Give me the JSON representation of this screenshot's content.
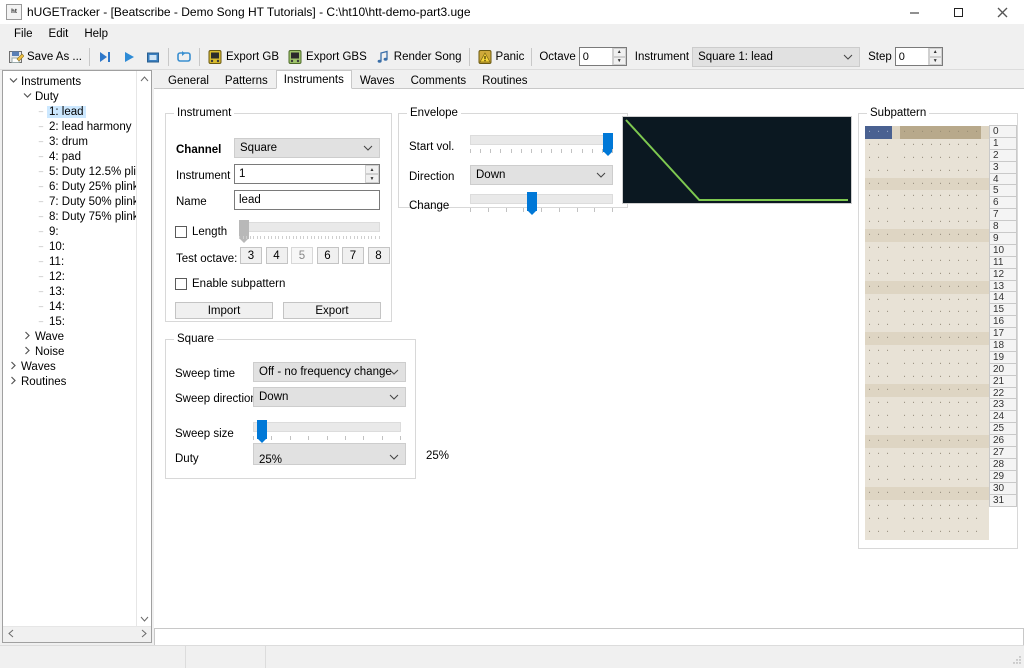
{
  "window": {
    "title": "hUGETracker - [Beatscribe - Demo Song HT Tutorials] - C:\\ht10\\htt-demo-part3.uge",
    "app_icon": "hugetracker-icon",
    "minimize": "–",
    "maximize": "☐",
    "close": "✕"
  },
  "menu": {
    "items": [
      "File",
      "Edit",
      "Help"
    ]
  },
  "toolbar": {
    "save_as": "Save As ...",
    "skip_label": "",
    "play_label": "",
    "stop_label": "",
    "loop_label": "",
    "export_gb": "Export GB",
    "export_gbs": "Export GBS",
    "render_song": "Render Song",
    "panic": "Panic",
    "octave_label": "Octave",
    "octave_value": "0",
    "instrument_label": "Instrument",
    "instrument_value": "Square 1: lead",
    "step_label": "Step",
    "step_value": "0"
  },
  "tree": {
    "nodes": [
      {
        "label": "Instruments",
        "depth": 0,
        "twist": "expanded",
        "selected": false
      },
      {
        "label": "Duty",
        "depth": 1,
        "twist": "expanded",
        "selected": false
      },
      {
        "label": "1: lead",
        "depth": 2,
        "twist": "leaf",
        "selected": true
      },
      {
        "label": "2: lead harmony",
        "depth": 2,
        "twist": "leaf",
        "selected": false
      },
      {
        "label": "3: drum",
        "depth": 2,
        "twist": "leaf",
        "selected": false
      },
      {
        "label": "4: pad",
        "depth": 2,
        "twist": "leaf",
        "selected": false
      },
      {
        "label": "5: Duty 12.5% plink",
        "depth": 2,
        "twist": "leaf",
        "selected": false
      },
      {
        "label": "6: Duty 25% plink",
        "depth": 2,
        "twist": "leaf",
        "selected": false
      },
      {
        "label": "7: Duty 50% plink",
        "depth": 2,
        "twist": "leaf",
        "selected": false
      },
      {
        "label": "8: Duty 75% plink",
        "depth": 2,
        "twist": "leaf",
        "selected": false
      },
      {
        "label": "9:",
        "depth": 2,
        "twist": "leaf",
        "selected": false
      },
      {
        "label": "10:",
        "depth": 2,
        "twist": "leaf",
        "selected": false
      },
      {
        "label": "11:",
        "depth": 2,
        "twist": "leaf",
        "selected": false
      },
      {
        "label": "12:",
        "depth": 2,
        "twist": "leaf",
        "selected": false
      },
      {
        "label": "13:",
        "depth": 2,
        "twist": "leaf",
        "selected": false
      },
      {
        "label": "14:",
        "depth": 2,
        "twist": "leaf",
        "selected": false
      },
      {
        "label": "15:",
        "depth": 2,
        "twist": "leaf",
        "selected": false
      },
      {
        "label": "Wave",
        "depth": 1,
        "twist": "collapsed",
        "selected": false
      },
      {
        "label": "Noise",
        "depth": 1,
        "twist": "collapsed",
        "selected": false
      },
      {
        "label": "Waves",
        "depth": 0,
        "twist": "collapsed",
        "selected": false
      },
      {
        "label": "Routines",
        "depth": 0,
        "twist": "collapsed",
        "selected": false
      }
    ]
  },
  "tabs": {
    "items": [
      "General",
      "Patterns",
      "Instruments",
      "Waves",
      "Comments",
      "Routines"
    ],
    "active": "Instruments"
  },
  "instrument_group": {
    "legend": "Instrument",
    "channel_label": "Channel",
    "channel_value": "Square",
    "instrument_label": "Instrument",
    "instrument_value": "1",
    "name_label": "Name",
    "name_value": "lead",
    "length_label": "Length",
    "length_checked": false,
    "length_slider_percent": 2,
    "test_octave_label": "Test octave:",
    "test_octaves": [
      "3",
      "4",
      "5",
      "6",
      "7",
      "8"
    ],
    "test_octave_pressed": "5",
    "enable_subpattern_label": "Enable subpattern",
    "enable_subpattern_checked": false,
    "import_label": "Import",
    "export_label": "Export"
  },
  "envelope_group": {
    "legend": "Envelope",
    "start_vol_label": "Start vol.",
    "start_vol_percent": 100,
    "direction_label": "Direction",
    "direction_value": "Down",
    "change_label": "Change",
    "change_percent": 42,
    "graph": {
      "line_color": "#7ec850",
      "background_color": "#0b1821",
      "decay_end_fraction": 0.33
    }
  },
  "square_group": {
    "legend": "Square",
    "sweep_time_label": "Sweep time",
    "sweep_time_value": "Off - no frequency change",
    "sweep_direction_label": "Sweep direction",
    "sweep_direction_value": "Down",
    "sweep_size_label": "Sweep size",
    "sweep_size_percent": 3,
    "duty_label": "Duty",
    "duty_value": "25%",
    "duty_readout": "25%"
  },
  "subpattern": {
    "legend": "Subpattern",
    "empty_cell": "·",
    "row_count": 32,
    "beat_interval": 4,
    "selected_row": 0,
    "selected_columns": 3,
    "rows": [
      "0",
      "1",
      "2",
      "3",
      "4",
      "5",
      "6",
      "7",
      "8",
      "9",
      "10",
      "11",
      "12",
      "13",
      "14",
      "15",
      "16",
      "17",
      "18",
      "19",
      "20",
      "21",
      "22",
      "23",
      "24",
      "25",
      "26",
      "27",
      "28",
      "29",
      "30",
      "31"
    ],
    "columns_group1": 3,
    "columns_group2": 9,
    "colors": {
      "grid_bg": "#e8e2d6",
      "beat_bg": "#ded5c3",
      "selection_bg": "#4a6191",
      "header_tan": "#b8a98b"
    }
  },
  "statusbar": {
    "panes": [
      "",
      "",
      ""
    ]
  }
}
